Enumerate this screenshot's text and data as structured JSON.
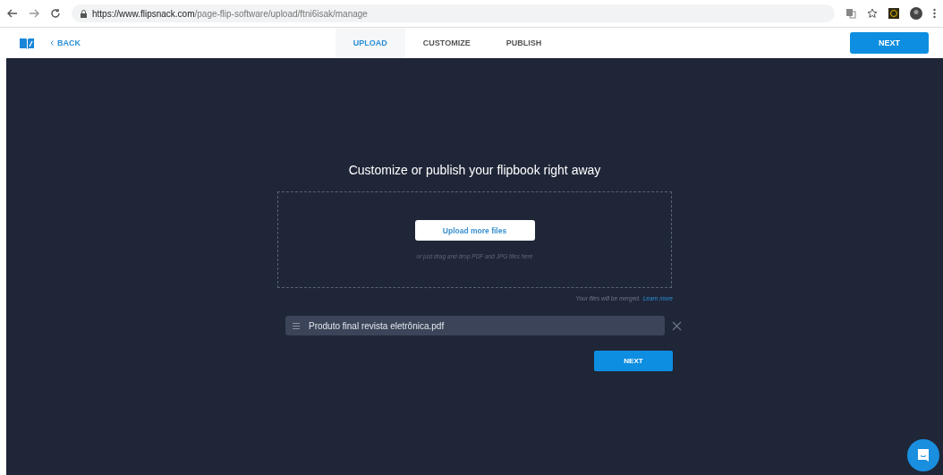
{
  "browser": {
    "url_host": "https://www.flipsnack.com",
    "url_path": "/page-flip-software/upload/ftni6isak/manage"
  },
  "header": {
    "back": "BACK",
    "tabs": [
      {
        "label": "UPLOAD",
        "selected": true
      },
      {
        "label": "CUSTOMIZE",
        "selected": false
      },
      {
        "label": "PUBLISH",
        "selected": false
      }
    ],
    "next": "NEXT"
  },
  "main": {
    "title": "Customize or publish your flipbook right away",
    "upload_button": "Upload more files",
    "drop_hint": "or just drag and drop PDF and JPG files here",
    "merge_note": "Your files will be merged.",
    "learn_more": "Learn more",
    "files": [
      {
        "name": "Produto final revista eletrônica.pdf"
      }
    ],
    "next": "NEXT"
  }
}
